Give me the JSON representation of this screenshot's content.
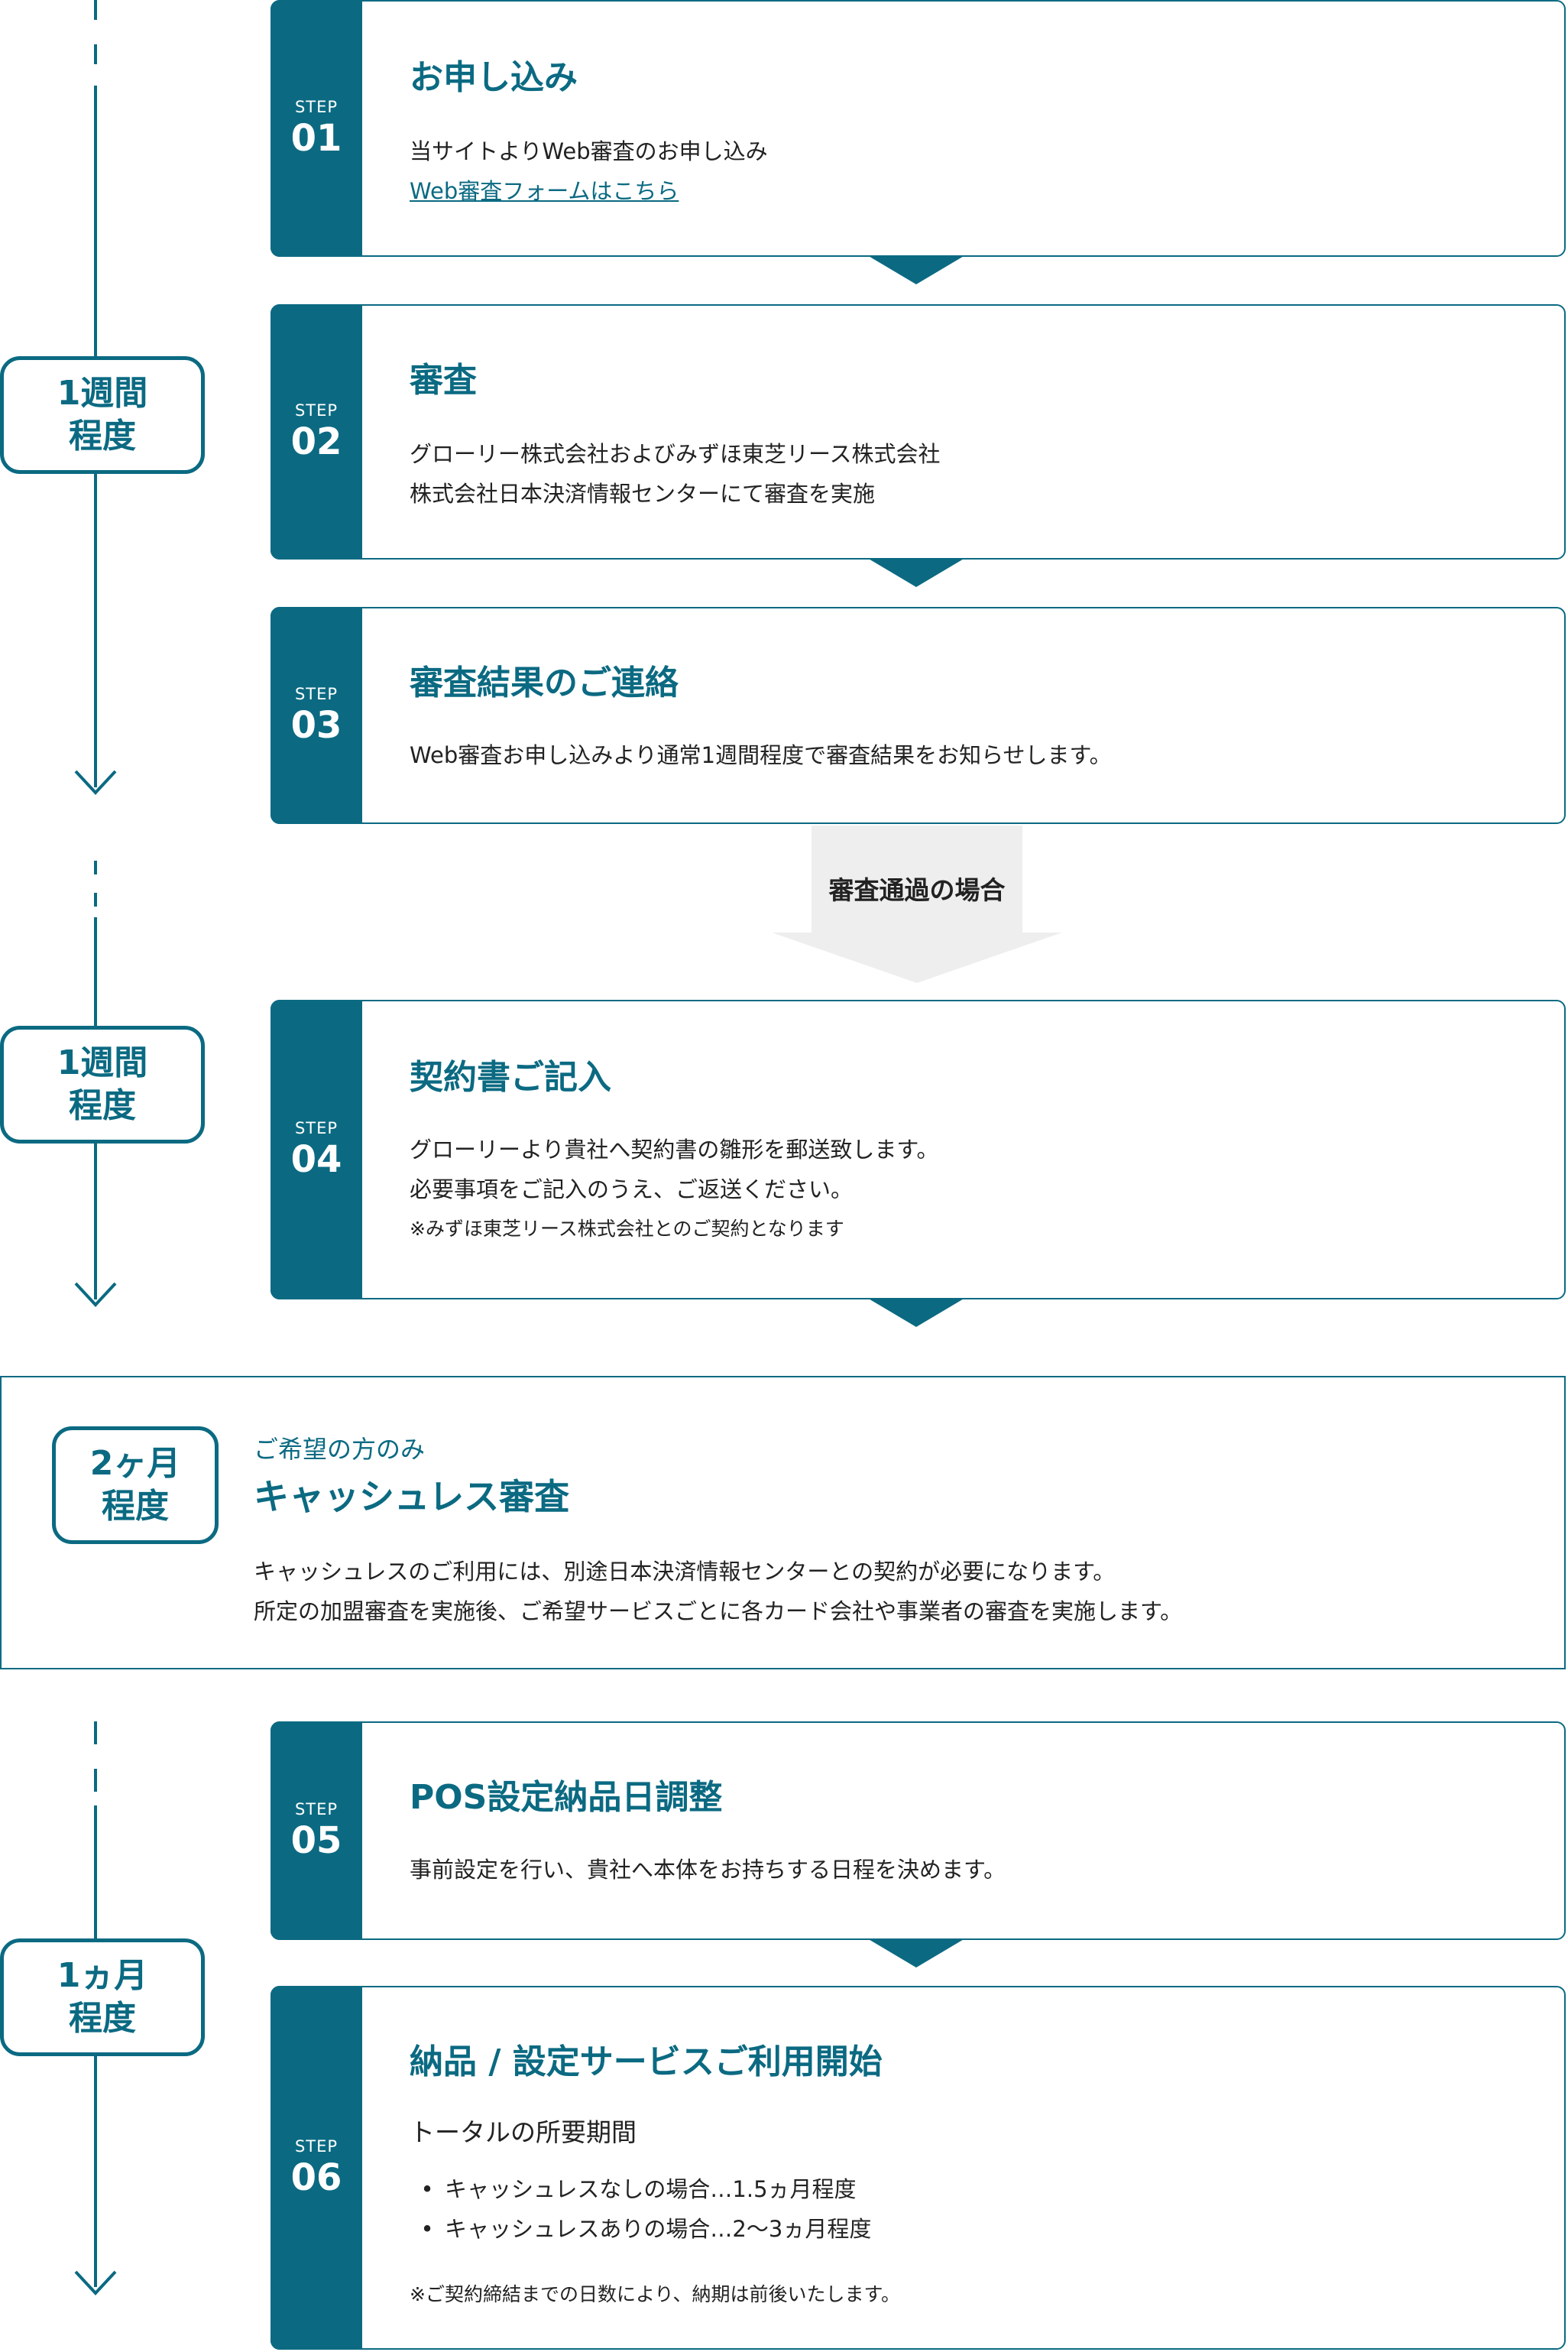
{
  "timeline": {
    "period1": "1週間\n程度",
    "period2": "1週間\n程度",
    "period3": "1ヵ月\n程度"
  },
  "steps": [
    {
      "step_word": "STEP",
      "number": "01",
      "title": "お申し込み",
      "lines": [
        "当サイトよりWeb審査のお申し込み"
      ],
      "link": "Web審査フォームはこちら"
    },
    {
      "step_word": "STEP",
      "number": "02",
      "title": "審査",
      "lines": [
        "グローリー株式会社およびみずほ東芝リース株式会社",
        "株式会社日本決済情報センターにて審査を実施"
      ]
    },
    {
      "step_word": "STEP",
      "number": "03",
      "title": "審査結果のご連絡",
      "lines": [
        "Web審査お申し込みより通常1週間程度で審査結果をお知らせします。"
      ]
    },
    {
      "step_word": "STEP",
      "number": "04",
      "title": "契約書ご記入",
      "lines": [
        "グローリーより貴社へ契約書の雛形を郵送致します。",
        "必要事項をご記入のうえ、ご返送ください。"
      ],
      "note": "※みずほ東芝リース株式会社とのご契約となります"
    },
    {
      "step_word": "STEP",
      "number": "05",
      "title": "POS設定納品日調整",
      "lines": [
        "事前設定を行い、貴社へ本体をお持ちする日程を決めます。"
      ]
    },
    {
      "step_word": "STEP",
      "number": "06",
      "title": "納品 / 設定サービスご利用開始",
      "total_heading": "トータルの所要期間",
      "bullets": [
        "キャッシュレスなしの場合…1.5ヵ月程度",
        "キャッシュレスありの場合…2〜3ヵ月程度"
      ],
      "note": "※ご契約締結までの日数により、納期は前後いたします。"
    }
  ],
  "passed": {
    "label": "審査通過の場合"
  },
  "cashless": {
    "period": "2ヶ月\n程度",
    "subtitle": "ご希望の方のみ",
    "title": "キャッシュレス審査",
    "lines": [
      "キャッシュレスのご利用には、別途日本決済情報センターとの契約が必要になります。",
      "所定の加盟審査を実施後、ご希望サービスごとに各カード会社や事業者の審査を実施します。"
    ]
  },
  "colors": {
    "accent": "#0b6a82",
    "text": "#222222",
    "arrow_fill": "#eeeeee"
  }
}
